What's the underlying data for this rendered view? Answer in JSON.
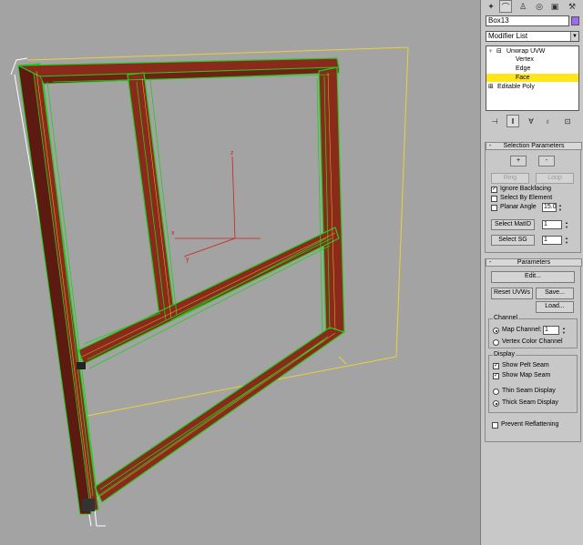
{
  "command_panel": {
    "tabs": [
      {
        "name": "create",
        "icon": "create-tab-icon",
        "glyph": "✦"
      },
      {
        "name": "modify",
        "icon": "modify-tab-icon",
        "glyph": "⌒"
      },
      {
        "name": "hierarchy",
        "icon": "hierarchy-tab-icon",
        "glyph": "♙"
      },
      {
        "name": "motion",
        "icon": "motion-tab-icon",
        "glyph": "◎"
      },
      {
        "name": "display",
        "icon": "display-tab-icon",
        "glyph": "▣"
      },
      {
        "name": "utilities",
        "icon": "utilities-tab-icon",
        "glyph": "⚒"
      }
    ],
    "object_name": "Box13",
    "object_color": "#9a6cf0",
    "modifier_list_label": "Modifier List",
    "stack": {
      "unwrap": "Unwrap UVW",
      "vertex": "Vertex",
      "edge": "Edge",
      "face": "Face",
      "editable_poly": "Editable Poly",
      "bulb_glyph": "♀",
      "minus_glyph": "⊟",
      "plus_glyph": "⊞"
    },
    "toolbar": {
      "pin_glyph": "⊣",
      "show_end_glyph": "‖",
      "unique_glyph": "∀",
      "remove_glyph": "♁",
      "configure_glyph": "⊡"
    }
  },
  "selection_parameters": {
    "title": "Selection Parameters",
    "collapse_glyph": "-",
    "grow_label": "+",
    "shrink_label": "-",
    "ring_label": "Ring",
    "loop_label": "Loop",
    "ignore_backfacing": "Ignore Backfacing",
    "select_by_element": "Select By Element",
    "planar_angle": "Planar Angle",
    "planar_angle_value": "15.0",
    "select_matid": "Select MatID",
    "matid_value": "1",
    "select_sg": "Select SG",
    "sg_value": "1"
  },
  "parameters": {
    "title": "Parameters",
    "collapse_glyph": "-",
    "edit_label": "Edit...",
    "reset_uvws_label": "Reset UVWs",
    "save_label": "Save...",
    "load_label": "Load...",
    "channel_group": "Channel",
    "map_channel": "Map Channel:",
    "map_channel_value": "1",
    "vertex_color_channel": "Vertex Color Channel",
    "display_group": "Display",
    "show_pelt_seam": "Show Pelt Seam",
    "show_map_seam": "Show Map Seam",
    "thin_seam_display": "Thin Seam Display",
    "thick_seam_display": "Thick Seam Display",
    "prevent_reflattening": "Prevent Reflattening"
  },
  "viewport": {
    "gizmo_label_z": "z",
    "gizmo_label_y": "y",
    "gizmo_label_x": "x"
  },
  "colors": {
    "viewport_bg": "#a3a3a3",
    "panel_bg": "#c8c8c8",
    "wood": "#8b2a1a",
    "wire": "#22cc22",
    "gizmo": "#e8d23a",
    "selection": "#ffe61a"
  }
}
